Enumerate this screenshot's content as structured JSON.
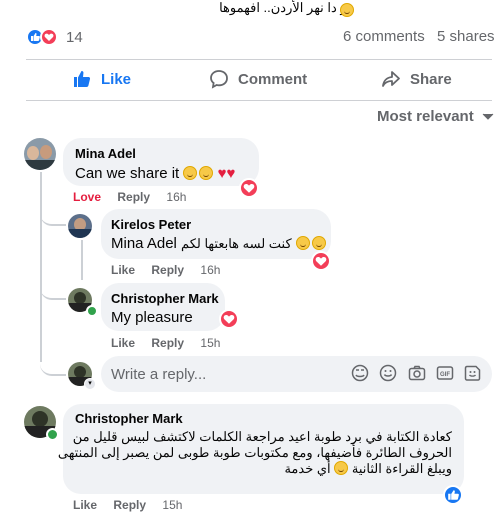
{
  "post": {
    "caption_fragment": "هو دا نهر الأردن.. افهموها",
    "reaction_count": "14",
    "comments_count": "6 comments",
    "shares_count": "5 shares"
  },
  "actions": {
    "like_label": "Like",
    "comment_label": "Comment",
    "share_label": "Share"
  },
  "sort": {
    "label": "Most relevant"
  },
  "comments": [
    {
      "author": "Mina Adel",
      "text": "Can we share it",
      "reaction_label": "Love",
      "reply_label": "Reply",
      "time": "16h"
    },
    {
      "author": "Kirelos Peter",
      "mention": "Mina Adel",
      "text": "كنت لسه هابعتها لكم",
      "like_label": "Like",
      "reply_label": "Reply",
      "time": "16h"
    },
    {
      "author": "Christopher Mark",
      "text": "My pleasure",
      "like_label": "Like",
      "reply_label": "Reply",
      "time": "15h"
    },
    {
      "author": "Christopher Mark",
      "text_line1": "كعادة الكتابة في برد طوبة اعيد مراجعة الكلمات لاكتشف لبيس قليل من",
      "text_line2": "الحروف الطائرة فأضيفها، ومع مكتوبات طوبة طوبى لمن يصبر إلى المنتهى",
      "text_line3": "ويبلغ القراءة الثانية",
      "text_line3_tail": "أي خدمة",
      "like_label": "Like",
      "reply_label": "Reply",
      "time": "15h"
    }
  ],
  "reply_box": {
    "placeholder": "Write a reply..."
  },
  "colors": {
    "like_blue": "#1877f2",
    "love_red": "#f33e58",
    "bubble_gray": "#f0f2f5",
    "meta_gray": "#65676b"
  }
}
